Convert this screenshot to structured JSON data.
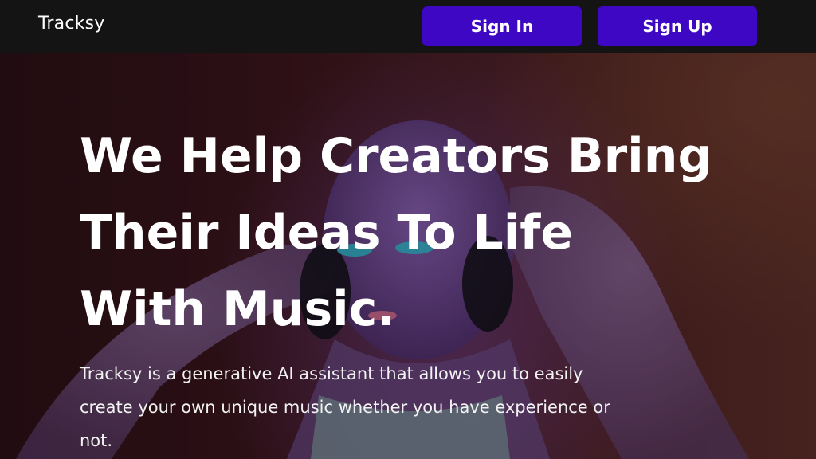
{
  "header": {
    "brand": "Tracksy",
    "signin_label": "Sign In",
    "signup_label": "Sign Up",
    "button_color": "#3d07c4"
  },
  "hero": {
    "headline_lines": [
      "We Help Creators Bring",
      "Their Ideas To Life",
      "With Music."
    ],
    "subtext": "Tracksy is a generative AI assistant that allows you to easily create your own unique music whether you have experience or not.",
    "background_image": "person-with-headphones-photo"
  }
}
